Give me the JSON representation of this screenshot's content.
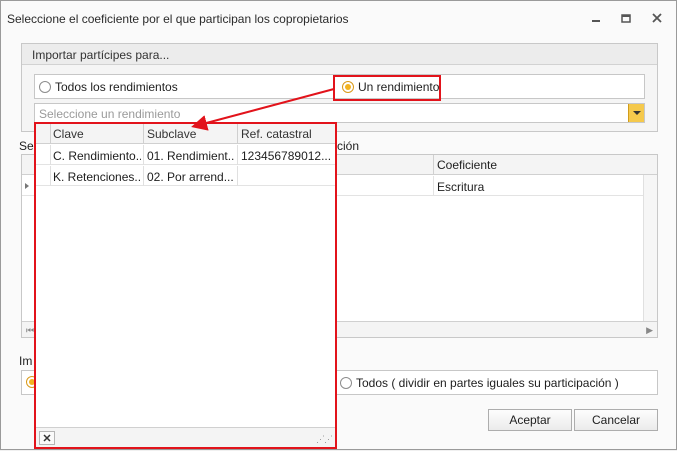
{
  "window": {
    "title": "Seleccione el coeficiente por el que participan los copropietarios",
    "minimize_icon": "minimize-icon",
    "maximize_icon": "restore-icon",
    "close_icon": "close-icon"
  },
  "import_group": {
    "title": "Importar partícipes para...",
    "options": [
      "Todos los rendimientos",
      "Un rendimiento"
    ],
    "selected": "Un rendimiento",
    "combo_placeholder": "Seleccione un rendimiento"
  },
  "main_grid": {
    "section_label_left": "Se",
    "section_label_right": "ción",
    "column_coeficiente": "Coeficiente",
    "row_value": "Escritura",
    "scroll_first_icon": "first-record-icon",
    "scroll_right_icon": "scroll-right-icon"
  },
  "lower_section": {
    "label": "Im",
    "option_todos": "Todos ( dividir en partes iguales su participación )"
  },
  "buttons": {
    "accept": "Aceptar",
    "cancel": "Cancelar"
  },
  "popup": {
    "columns": [
      "Clave",
      "Subclave",
      "Ref. catastral"
    ],
    "rows": [
      [
        "C. Rendimiento...",
        "01. Rendimient...",
        "123456789012..."
      ],
      [
        "K. Retenciones...",
        "02. Por arrend...",
        ""
      ]
    ],
    "close_icon": "close-icon",
    "resize_icon": "resize-grip-icon"
  },
  "colors": {
    "highlight": "#e2131b",
    "radio_accent": "#f2b320"
  }
}
